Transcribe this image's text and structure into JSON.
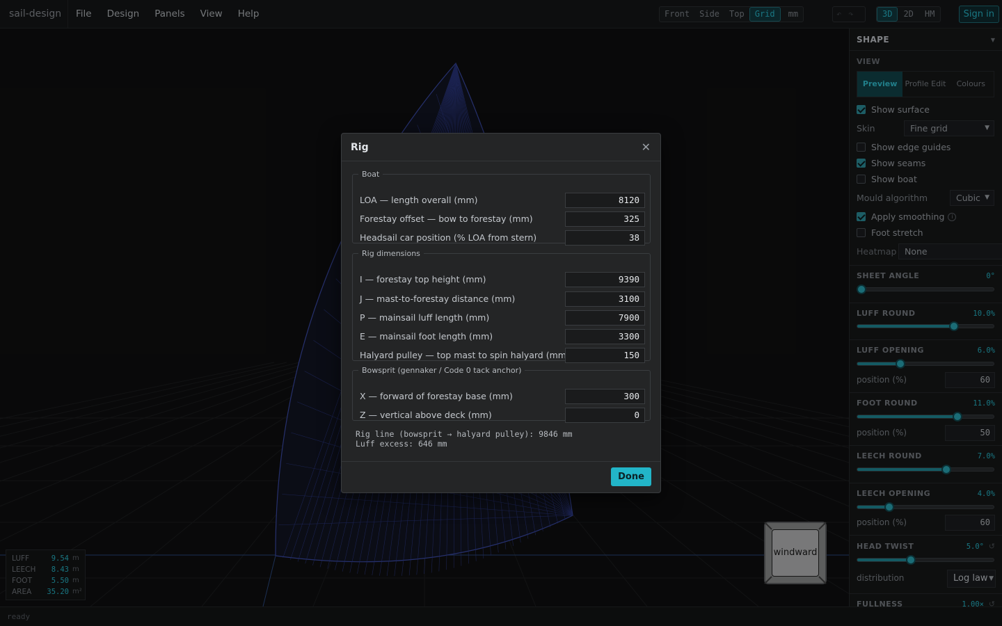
{
  "app": {
    "title": "sail-design"
  },
  "menu": [
    "File",
    "Design",
    "Panels",
    "View",
    "Help"
  ],
  "toolbar": {
    "views": [
      {
        "label": "Front",
        "active": false
      },
      {
        "label": "Side",
        "active": false
      },
      {
        "label": "Top",
        "active": false
      },
      {
        "label": "Grid",
        "active": true
      },
      {
        "label": "mm",
        "active": false
      }
    ],
    "undo_icon": "undo-icon",
    "redo_icon": "redo-icon",
    "modes": [
      {
        "label": "3D",
        "active": true
      },
      {
        "label": "2D",
        "active": false
      },
      {
        "label": "HM",
        "active": false
      }
    ],
    "signin_label": "Sign in"
  },
  "viewport": {
    "stats": [
      {
        "label": "LUFF",
        "value": "9.54",
        "unit": "m"
      },
      {
        "label": "LEECH",
        "value": "8.43",
        "unit": "m"
      },
      {
        "label": "FOOT",
        "value": "5.50",
        "unit": "m"
      },
      {
        "label": "AREA",
        "value": "35.20",
        "unit": "m²"
      }
    ],
    "cube_label": "windward"
  },
  "status": {
    "text": "ready"
  },
  "panel": {
    "title": "SHAPE",
    "view_label": "VIEW",
    "view_tabs": [
      {
        "label": "Preview",
        "active": true
      },
      {
        "label": "Profile Edit",
        "active": false
      },
      {
        "label": "Colours",
        "active": false
      }
    ],
    "show_surface": {
      "label": "Show surface",
      "checked": true
    },
    "skin": {
      "label": "Skin",
      "value": "Fine grid"
    },
    "show_edge_guides": {
      "label": "Show edge guides",
      "checked": false
    },
    "show_seams": {
      "label": "Show seams",
      "checked": true
    },
    "show_boat": {
      "label": "Show boat",
      "checked": false
    },
    "mould": {
      "label": "Mould algorithm",
      "value": "Cubic"
    },
    "apply_smoothing": {
      "label": "Apply smoothing",
      "checked": true
    },
    "foot_stretch": {
      "label": "Foot stretch",
      "checked": false
    },
    "heatmap": {
      "label": "Heatmap",
      "value": "None"
    },
    "sheet_angle": {
      "title": "SHEET ANGLE",
      "value": "0°",
      "fraction": 0.0
    },
    "luff_round": {
      "title": "LUFF ROUND",
      "value": "10.0%",
      "fraction": 0.73
    },
    "luff_opening": {
      "title": "LUFF OPENING",
      "value": "6.0%",
      "fraction": 0.31,
      "position_label": "position (%)",
      "position": "60"
    },
    "foot_round": {
      "title": "FOOT ROUND",
      "value": "11.0%",
      "fraction": 0.76,
      "position_label": "position (%)",
      "position": "50"
    },
    "leech_round": {
      "title": "LEECH ROUND",
      "value": "7.0%",
      "fraction": 0.67
    },
    "leech_opening": {
      "title": "LEECH OPENING",
      "value": "4.0%",
      "fraction": 0.22,
      "position_label": "position (%)",
      "position": "60"
    },
    "head_twist": {
      "title": "HEAD TWIST",
      "value": "5.0°",
      "fraction": 0.39,
      "distribution_label": "distribution",
      "distribution": "Log law"
    },
    "fullness": {
      "title": "FULLNESS",
      "value": "1.00×"
    }
  },
  "modal": {
    "title": "Rig",
    "close_icon": "close-icon",
    "boat": {
      "legend": "Boat",
      "rows": [
        {
          "label": "LOA — length overall (mm)",
          "value": "8120"
        },
        {
          "label": "Forestay offset — bow to forestay (mm)",
          "value": "325"
        },
        {
          "label": "Headsail car position (% LOA from stern)",
          "value": "38"
        }
      ]
    },
    "rig": {
      "legend": "Rig dimensions",
      "rows": [
        {
          "label": "I — forestay top height (mm)",
          "value": "9390"
        },
        {
          "label": "J — mast-to-forestay distance (mm)",
          "value": "3100"
        },
        {
          "label": "P — mainsail luff length (mm)",
          "value": "7900"
        },
        {
          "label": "E — mainsail foot length (mm)",
          "value": "3300"
        },
        {
          "label": "Halyard pulley — top mast to spin halyard (mm)",
          "value": "150"
        }
      ]
    },
    "bowsprit": {
      "legend": "Bowsprit (gennaker / Code 0 tack anchor)",
      "rows": [
        {
          "label": "X — forward of forestay base (mm)",
          "value": "300"
        },
        {
          "label": "Z — vertical above deck (mm)",
          "value": "0"
        }
      ]
    },
    "summary_line1": "Rig line (bowsprit → halyard pulley): 9846 mm",
    "summary_line2": "Luff excess: 646 mm",
    "done_label": "Done"
  },
  "colors": {
    "accent": "#22b5c8",
    "background": "#0f0f10",
    "mesh": "#3b4ba8"
  }
}
